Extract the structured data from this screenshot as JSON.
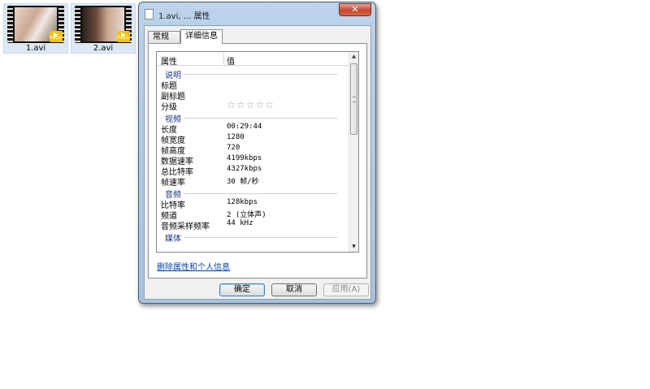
{
  "desktop": {
    "files": [
      {
        "name": "1.avi",
        "badge": "Player"
      },
      {
        "name": "2.avi",
        "badge": "Player"
      }
    ]
  },
  "dialog": {
    "title": "1.avi, ... 属性",
    "close_label": "✕",
    "tabs": [
      "常规",
      "详细信息"
    ],
    "columns": [
      "属性",
      "值"
    ],
    "sections": {
      "description": {
        "title": "说明",
        "rows": [
          {
            "key": "标题",
            "value": ""
          },
          {
            "key": "副标题",
            "value": ""
          },
          {
            "key": "分级",
            "value": ""
          }
        ],
        "rating": "☆☆☆☆☆"
      },
      "video": {
        "title": "视频",
        "rows": [
          {
            "key": "长度",
            "value": "00:29:44"
          },
          {
            "key": "帧宽度",
            "value": "1280"
          },
          {
            "key": "帧高度",
            "value": "720"
          },
          {
            "key": "数据速率",
            "value": "4199kbps"
          },
          {
            "key": "总比特率",
            "value": "4327kbps"
          },
          {
            "key": "帧速率",
            "value": "30 帧/秒"
          }
        ]
      },
      "audio": {
        "title": "音频",
        "rows": [
          {
            "key": "比特率",
            "value": "128kbps"
          },
          {
            "key": "频道",
            "value": "2 (立体声)"
          },
          {
            "key": "音频采样频率",
            "value": "44 kHz"
          }
        ]
      },
      "media": {
        "title": "媒体"
      }
    },
    "remove_link": "删除属性和个人信息",
    "buttons": {
      "ok": "确定",
      "cancel": "取消",
      "apply": "应用(A)"
    }
  }
}
